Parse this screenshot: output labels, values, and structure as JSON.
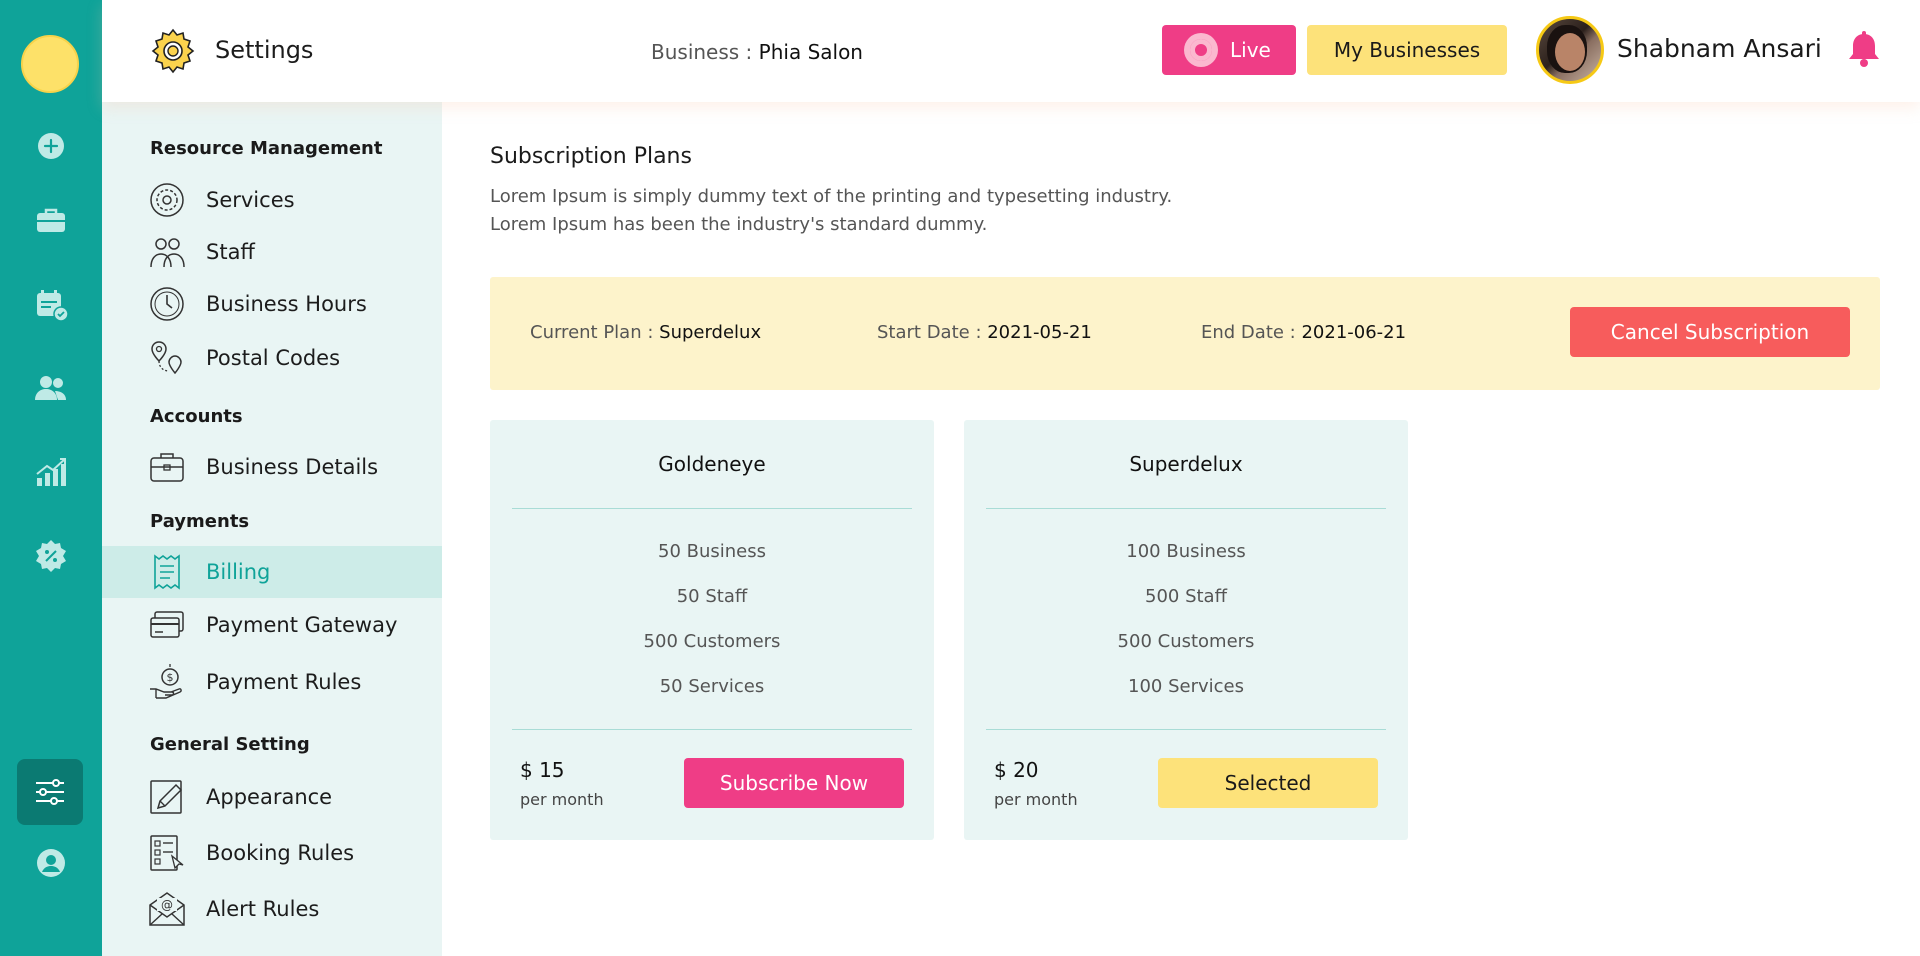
{
  "rail": {
    "icons": [
      "add-icon",
      "briefcase-icon",
      "calendar-check-icon",
      "users-icon",
      "analytics-icon",
      "discount-icon",
      "settings-sliders-icon",
      "profile-icon"
    ],
    "active": "settings-sliders-icon"
  },
  "header": {
    "title": "Settings",
    "business_label": "Business : ",
    "business_name": "Phia Salon",
    "live_label": "Live",
    "my_businesses_label": "My Businesses",
    "user_name": "Shabnam Ansari"
  },
  "sidebar": {
    "sections": [
      {
        "title": "Resource Management",
        "items": [
          {
            "label": "Services",
            "icon": "services-icon"
          },
          {
            "label": "Staff",
            "icon": "staff-icon"
          },
          {
            "label": "Business Hours",
            "icon": "clock-icon"
          },
          {
            "label": "Postal Codes",
            "icon": "location-pin-icon"
          }
        ]
      },
      {
        "title": "Accounts",
        "items": [
          {
            "label": "Business Details",
            "icon": "briefcase-icon"
          }
        ]
      },
      {
        "title": "Payments",
        "items": [
          {
            "label": "Billing",
            "icon": "receipt-icon"
          },
          {
            "label": "Payment Gateway",
            "icon": "card-icon"
          },
          {
            "label": "Payment Rules",
            "icon": "hand-dollar-icon"
          }
        ]
      },
      {
        "title": "General Setting",
        "items": [
          {
            "label": "Appearance",
            "icon": "pencil-icon"
          },
          {
            "label": "Booking Rules",
            "icon": "checklist-icon"
          },
          {
            "label": "Alert Rules",
            "icon": "envelope-at-icon"
          }
        ]
      }
    ],
    "active_item": "Billing"
  },
  "main": {
    "title": "Subscription Plans",
    "description_line1": "Lorem Ipsum is simply dummy text of the printing and typesetting industry.",
    "description_line2": "Lorem Ipsum has been the industry's standard dummy.",
    "current_plan": {
      "plan_label": "Current Plan : ",
      "plan_value": "Superdelux",
      "start_label": "Start Date : ",
      "start_value": "2021-05-21",
      "end_label": "End Date : ",
      "end_value": "2021-06-21",
      "cancel_label": "Cancel Subscription"
    },
    "plans": [
      {
        "name": "Goldeneye",
        "features": [
          "50 Business",
          "50 Staff",
          "500 Customers",
          "50 Services"
        ],
        "price": "$ 15",
        "period": "per month",
        "button": "Subscribe Now"
      },
      {
        "name": "Superdelux",
        "features": [
          "100 Business",
          "500 Staff",
          "500 Customers",
          "100 Services"
        ],
        "price": "$ 20",
        "period": "per month",
        "button": "Selected"
      }
    ]
  },
  "colors": {
    "teal": "#0fa399",
    "pink": "#ef3d86",
    "yellow": "#fde27a",
    "red": "#f75c5c",
    "light_teal": "#e9f5f4",
    "cream": "#fdf3cb"
  }
}
